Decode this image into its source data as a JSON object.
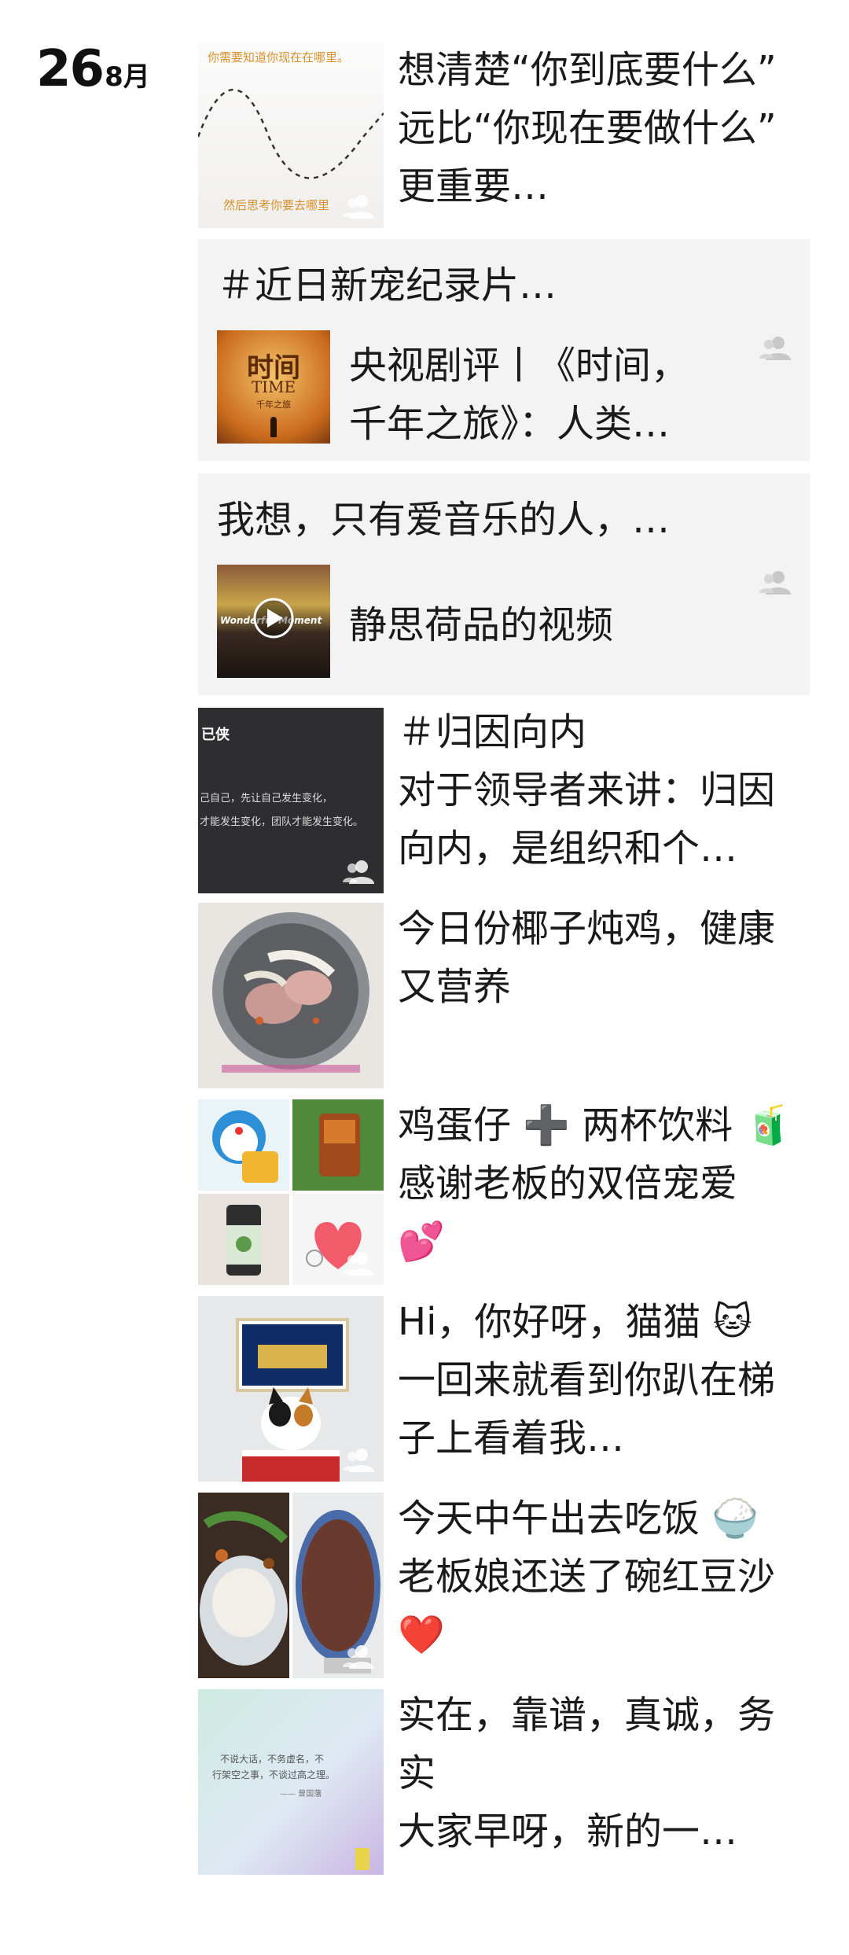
{
  "date": {
    "day": "26",
    "month": "8月"
  },
  "posts": [
    {
      "text": "想清楚“你到底要什么”\n远比“你现在要做什么”\n更重要…",
      "thumb_top_text": "你需要知道你现在在哪里。",
      "thumb_bottom_text": "然后思考你要去哪里"
    },
    {
      "share_title": "＃近日新宠纪录片…",
      "share_text": "央视剧评丨《时间，\n千年之旅》：人类…",
      "thumb_title": "时间",
      "thumb_sub": "TIME",
      "thumb_small": "千年之旅"
    },
    {
      "share_title": "我想，只有爱音乐的人，…",
      "share_text": "静思荷品的视频",
      "thumb_caption": "Wonderful Moment"
    },
    {
      "text": "＃归因向内\n对于领导者来讲：归因\n向内，是组织和个…",
      "thumb_line1": "已侠",
      "thumb_line2": "己自己，先让自己发生变化，",
      "thumb_line3": "才能发生变化，团队才能发生变化。"
    },
    {
      "text": "今日份椰子炖鸡，健康\n又营养"
    },
    {
      "text": "鸡蛋仔 ➕ 两杯饮料 🧃\n感谢老板的双倍宠爱\n💕"
    },
    {
      "text": "Hi，你好呀，猫猫 🐱\n一回来就看到你趴在梯\n子上看着我…"
    },
    {
      "text": "今天中午出去吃饭 🍚\n老板娘还送了碗红豆沙\n❤️"
    },
    {
      "text": "实在，靠谱，真诚，务\n实\n大家早呀，新的一…",
      "thumb_line1": "不说大话，不务虚名，不",
      "thumb_line2": "行架空之事，不谈过高之理。",
      "thumb_line3": "—— 曾国藩"
    }
  ],
  "colors": {
    "card_bg": "#f3f3f3",
    "text": "#1a1a1a",
    "icon_gray": "#c8c8c8"
  },
  "icons": [
    "friends-visibility-icon",
    "play-icon"
  ]
}
